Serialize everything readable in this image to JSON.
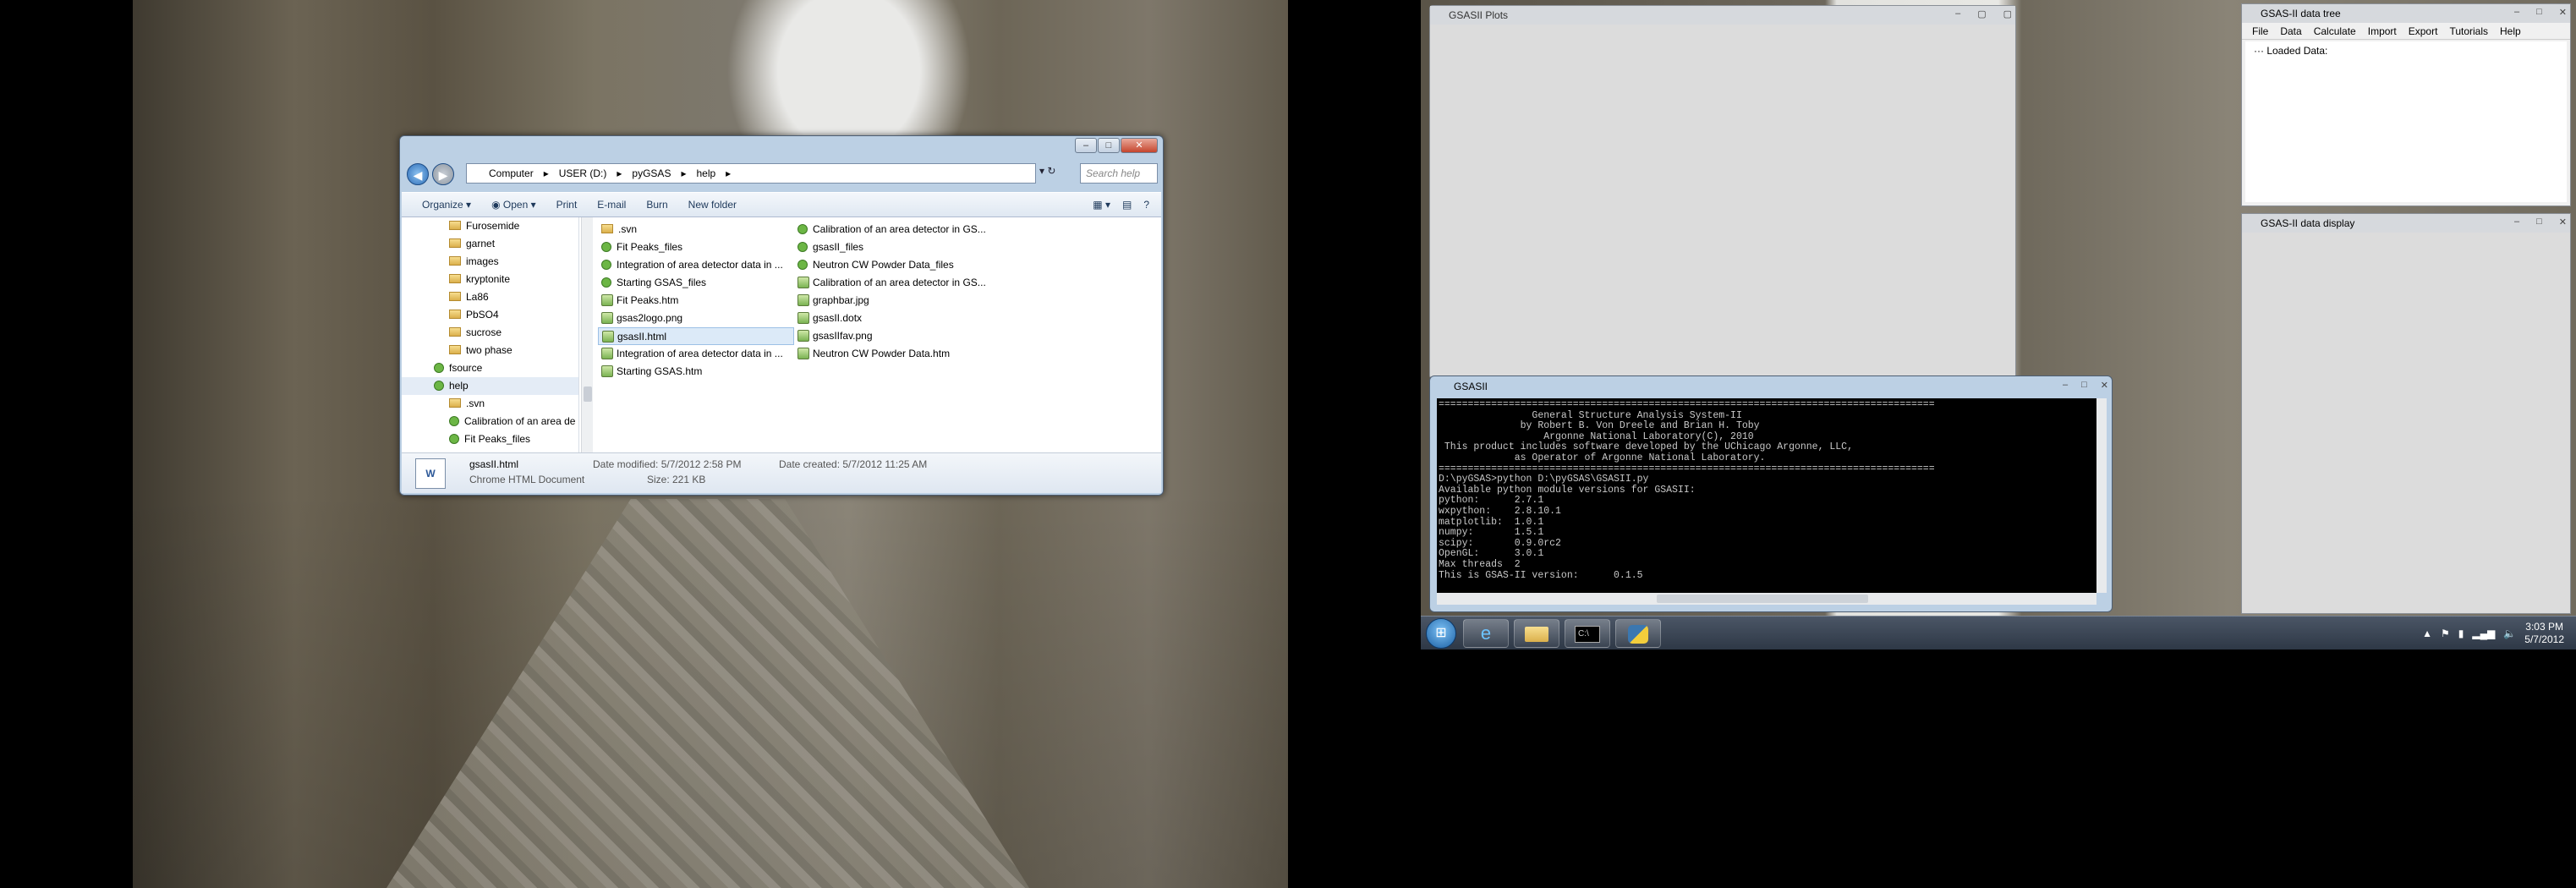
{
  "explorer": {
    "breadcrumb": [
      "Computer",
      "USER (D:)",
      "pyGSAS",
      "help"
    ],
    "search_placeholder": "Search help",
    "toolbar": {
      "organize": "Organize",
      "open": "Open",
      "print": "Print",
      "email": "E-mail",
      "burn": "Burn",
      "new_folder": "New folder"
    },
    "tree": [
      "Furosemide",
      "garnet",
      "images",
      "kryptonite",
      "La86",
      "PbSO4",
      "sucrose",
      "two phase",
      "fsource",
      "help",
      ".svn",
      "Calibration of an area de",
      "Fit Peaks_files"
    ],
    "files_col1": [
      ".svn",
      "Fit Peaks_files",
      "Integration of area detector data in ...",
      "Starting GSAS_files",
      "Fit Peaks.htm",
      "gsas2logo.png",
      "gsasII.html",
      "Integration of area detector data in ...",
      "Starting GSAS.htm"
    ],
    "files_col2": [
      "Calibration of an area detector in GS...",
      "gsasII_files",
      "Neutron CW Powder Data_files",
      "Calibration of an area detector in GS...",
      "graphbar.jpg",
      "gsasII.dotx",
      "gsasIIfav.png",
      "Neutron CW Powder Data.htm"
    ],
    "details": {
      "name": "gsasII.html",
      "type": "Chrome HTML Document",
      "modified": "Date modified: 5/7/2012 2:58 PM",
      "size": "Size: 221 KB",
      "created": "Date created: 5/7/2012 11:25 AM"
    }
  },
  "plots": {
    "title": "GSASII Plots"
  },
  "console": {
    "title": "GSASII",
    "lines": [
      "=====================================================================================",
      "                General Structure Analysis System-II",
      "              by Robert B. Von Dreele and Brian H. Toby",
      "                  Argonne National Laboratory(C), 2010",
      " This product includes software developed by the UChicago Argonne, LLC,",
      "             as Operator of Argonne National Laboratory.",
      "=====================================================================================",
      "",
      "D:\\pyGSAS>python D:\\pyGSAS\\GSASII.py",
      "Available python module versions for GSASII:",
      "python:      2.7.1",
      "wxpython:    2.8.10.1",
      "matplotlib:  1.0.1",
      "numpy:       1.5.1",
      "scipy:       0.9.0rc2",
      "OpenGL:      3.0.1",
      "Max threads  2",
      "This is GSAS-II version:      0.1.5"
    ]
  },
  "datatree": {
    "title": "GSAS-II data tree",
    "menu": [
      "File",
      "Data",
      "Calculate",
      "Import",
      "Export",
      "Tutorials",
      "Help"
    ],
    "root": "Loaded Data:"
  },
  "datadisplay": {
    "title": "GSAS-II data display"
  },
  "clock": {
    "time": "3:03 PM",
    "date": "5/7/2012"
  }
}
